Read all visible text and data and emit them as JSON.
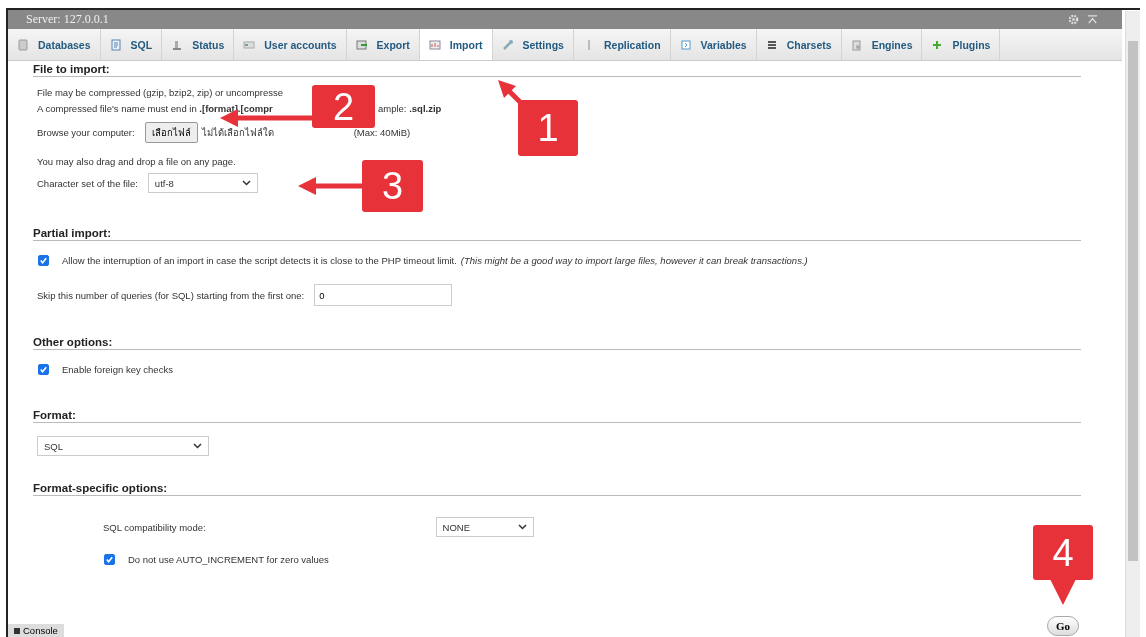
{
  "window": {
    "title": "Server: 127.0.0.1"
  },
  "tabs": [
    {
      "label": "Databases",
      "selected": false
    },
    {
      "label": "SQL",
      "selected": false
    },
    {
      "label": "Status",
      "selected": false
    },
    {
      "label": "User accounts",
      "selected": false
    },
    {
      "label": "Export",
      "selected": false
    },
    {
      "label": "Import",
      "selected": true
    },
    {
      "label": "Settings",
      "selected": false
    },
    {
      "label": "Replication",
      "selected": false
    },
    {
      "label": "Variables",
      "selected": false
    },
    {
      "label": "Charsets",
      "selected": false
    },
    {
      "label": "Engines",
      "selected": false
    },
    {
      "label": "Plugins",
      "selected": false
    }
  ],
  "sections": [
    {
      "title": "File to import:",
      "items": [
        {
          "kind": "text",
          "parts": [
            "File may be compressed (gzip, bzip2, zip) or uncompresse"
          ]
        },
        {
          "kind": "text",
          "parts": [
            "A compressed file's name must end in **.[format].[compr**",
            "ample: **.sql.zip**"
          ]
        },
        {
          "kind": "file",
          "label": "Browse your computer:",
          "button": "เลือกไฟล์",
          "status": "ไม่ได้เลือกไฟล์ใด",
          "limit": "(Max: 40MiB)"
        },
        {
          "kind": "text",
          "parts": [
            "You may also drag and drop a file on any page."
          ]
        },
        {
          "kind": "select",
          "label": "Character set of the file:",
          "value": "utf-8"
        }
      ]
    },
    {
      "title": "Partial import:",
      "items": [
        {
          "kind": "checkbox",
          "checked": true,
          "label": "Allow the interruption of an import in case the script detects it is close to the PHP timeout limit.",
          "note": "(This might be a good way to import large files, however it can break transactions.)"
        },
        {
          "kind": "number",
          "label": "Skip this number of queries (for SQL) starting from the first one:",
          "value": "0"
        }
      ]
    },
    {
      "title": "Other options:",
      "items": [
        {
          "kind": "checkbox",
          "checked": true,
          "label": "Enable foreign key checks"
        }
      ]
    },
    {
      "title": "Format:",
      "items": [
        {
          "kind": "select",
          "value": "SQL"
        }
      ]
    },
    {
      "title": "Format-specific options:",
      "items": [
        {
          "kind": "select",
          "label": "SQL compatibility mode:",
          "value": "NONE"
        },
        {
          "kind": "checkbox",
          "checked": true,
          "label": "Do not use AUTO_INCREMENT for zero values"
        }
      ]
    }
  ],
  "go_button": "Go",
  "console_button": "Console",
  "callouts": [
    {
      "number": "1"
    },
    {
      "number": "2"
    },
    {
      "number": "3"
    },
    {
      "number": "4"
    }
  ]
}
